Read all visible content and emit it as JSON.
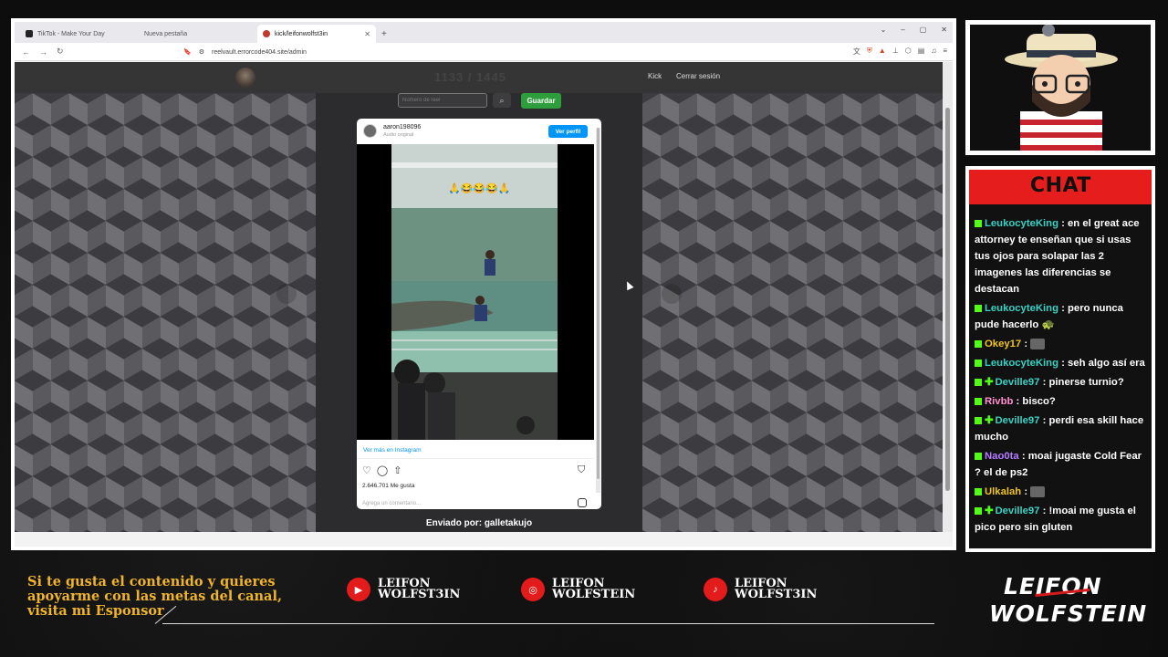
{
  "browser": {
    "tabs": [
      {
        "label": "TikTok - Make Your Day",
        "active": false
      },
      {
        "label": "Nueva pestaña",
        "active": false
      },
      {
        "label": "kick/leifonwolfst3in",
        "active": true
      }
    ],
    "url": "reelvault.errorcode404.site/admin"
  },
  "site": {
    "counter": "1133 / 1445",
    "nav_kick": "Kick",
    "nav_logout": "Cerrar sesión",
    "reel_input_placeholder": "Número de reel",
    "save_label": "Guardar",
    "sent_by": "Enviado por: galletakujo"
  },
  "instagram": {
    "username": "aaron198096",
    "audio": "Audio original",
    "view_profile": "Ver perfil",
    "emoji_caption": "🙏😂😂😂🙏",
    "more_on_instagram": "Ver más en Instagram",
    "likes": "2.646.701 Me gusta",
    "comment_placeholder": "Agrega un comentario..."
  },
  "chat": {
    "title": "CHAT",
    "messages": [
      {
        "user": "LeukocyteKing",
        "color": "teal",
        "text": ": en el great ace attorney te enseñan que si usas tus ojos para solapar las 2 imagenes las diferencias se destacan"
      },
      {
        "user": "LeukocyteKing",
        "color": "teal",
        "text": ": pero nunca pude hacerlo 🐢"
      },
      {
        "user": "Okey17",
        "color": "yellow",
        "text": ":"
      },
      {
        "user": "LeukocyteKing",
        "color": "teal",
        "text": ": seh algo así era"
      },
      {
        "user": "Deville97",
        "color": "teal",
        "text": ": pinerse turnio?"
      },
      {
        "user": "Rivbb",
        "color": "pink",
        "text": ": bisco?"
      },
      {
        "user": "Deville97",
        "color": "teal",
        "text": ": perdi esa skill hace mucho"
      },
      {
        "user": "Nao0ta",
        "color": "purple",
        "text": ": moai jugaste Cold Fear ? el de ps2"
      },
      {
        "user": "Ulkalah",
        "color": "yellow",
        "text": ":"
      },
      {
        "user": "Deville97",
        "color": "teal",
        "text": ": !moai me gusta el pico pero sin gluten"
      }
    ]
  },
  "overlay": {
    "support_line1": "Si te gusta el contenido y quieres",
    "support_line2": "apoyarme con las metas del canal,",
    "support_line3": "visita mi Esponsor",
    "socials": [
      {
        "icon": "youtube-icon",
        "line1": "LEIFON",
        "line2": "WOLFST3IN"
      },
      {
        "icon": "instagram-icon",
        "line1": "LEIFON",
        "line2": "WOLFSTEIN"
      },
      {
        "icon": "tiktok-icon",
        "line1": "LEIFON",
        "line2": "WOLFST3IN"
      }
    ],
    "brand_line1": "LEIFON",
    "brand_line2": "WOLFSTEIN"
  },
  "colors": {
    "accent_red": "#e51d1d",
    "kick_green": "#53fc18",
    "save_green": "#2e9e3c",
    "ig_blue": "#0095f6",
    "support_gold": "#f0b429"
  }
}
